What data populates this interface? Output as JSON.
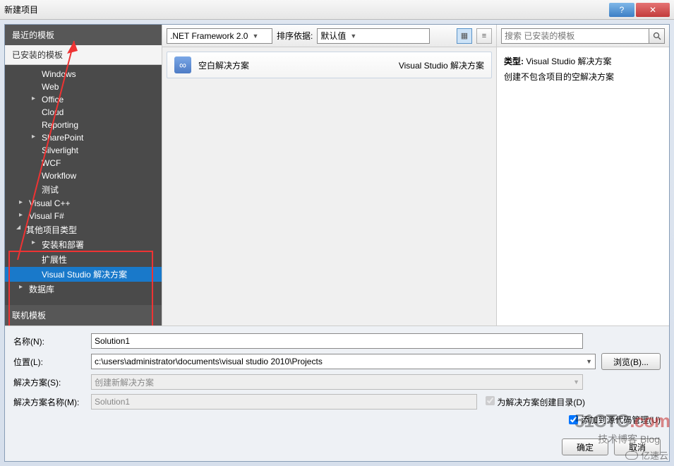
{
  "window": {
    "title": "新建项目",
    "help": "?",
    "close": "✕"
  },
  "sidebar": {
    "recent_header": "最近的模板",
    "installed_header": "已安装的模板",
    "online_header": "联机模板",
    "tree": {
      "windows": "Windows",
      "web": "Web",
      "office": "Office",
      "cloud": "Cloud",
      "reporting": "Reporting",
      "sharepoint": "SharePoint",
      "silverlight": "Silverlight",
      "wcf": "WCF",
      "workflow": "Workflow",
      "test": "测试",
      "visual_cpp": "Visual C++",
      "visual_fsharp": "Visual F#",
      "other_project_types": "其他项目类型",
      "setup_deploy": "安装和部署",
      "extensibility": "扩展性",
      "vs_solutions": "Visual Studio 解决方案",
      "database": "数据库"
    }
  },
  "toolbar": {
    "framework": ".NET Framework 2.0",
    "sort_label": "排序依据:",
    "sort_value": "默认值"
  },
  "template": {
    "name": "空白解决方案",
    "lang": "Visual Studio 解决方案"
  },
  "right": {
    "search_placeholder": "搜索 已安装的模板",
    "type_label": "类型:",
    "type_value": "Visual Studio 解决方案",
    "desc": "创建不包含项目的空解决方案"
  },
  "form": {
    "name_label": "名称(N):",
    "name_value": "Solution1",
    "location_label": "位置(L):",
    "location_value": "c:\\users\\administrator\\documents\\visual studio 2010\\Projects",
    "browse": "浏览(B)...",
    "solution_label": "解决方案(S):",
    "solution_value": "创建新解决方案",
    "solution_name_label": "解决方案名称(M):",
    "solution_name_value": "Solution1",
    "create_dir": "为解决方案创建目录(D)",
    "add_scc": "添加到源代码管理(U)"
  },
  "buttons": {
    "ok": "确定",
    "cancel": "取消"
  },
  "watermarks": {
    "w1a": "51CTO",
    "w1b": ".com",
    "w2": "技术博客 Blog",
    "w3": "亿速云"
  }
}
